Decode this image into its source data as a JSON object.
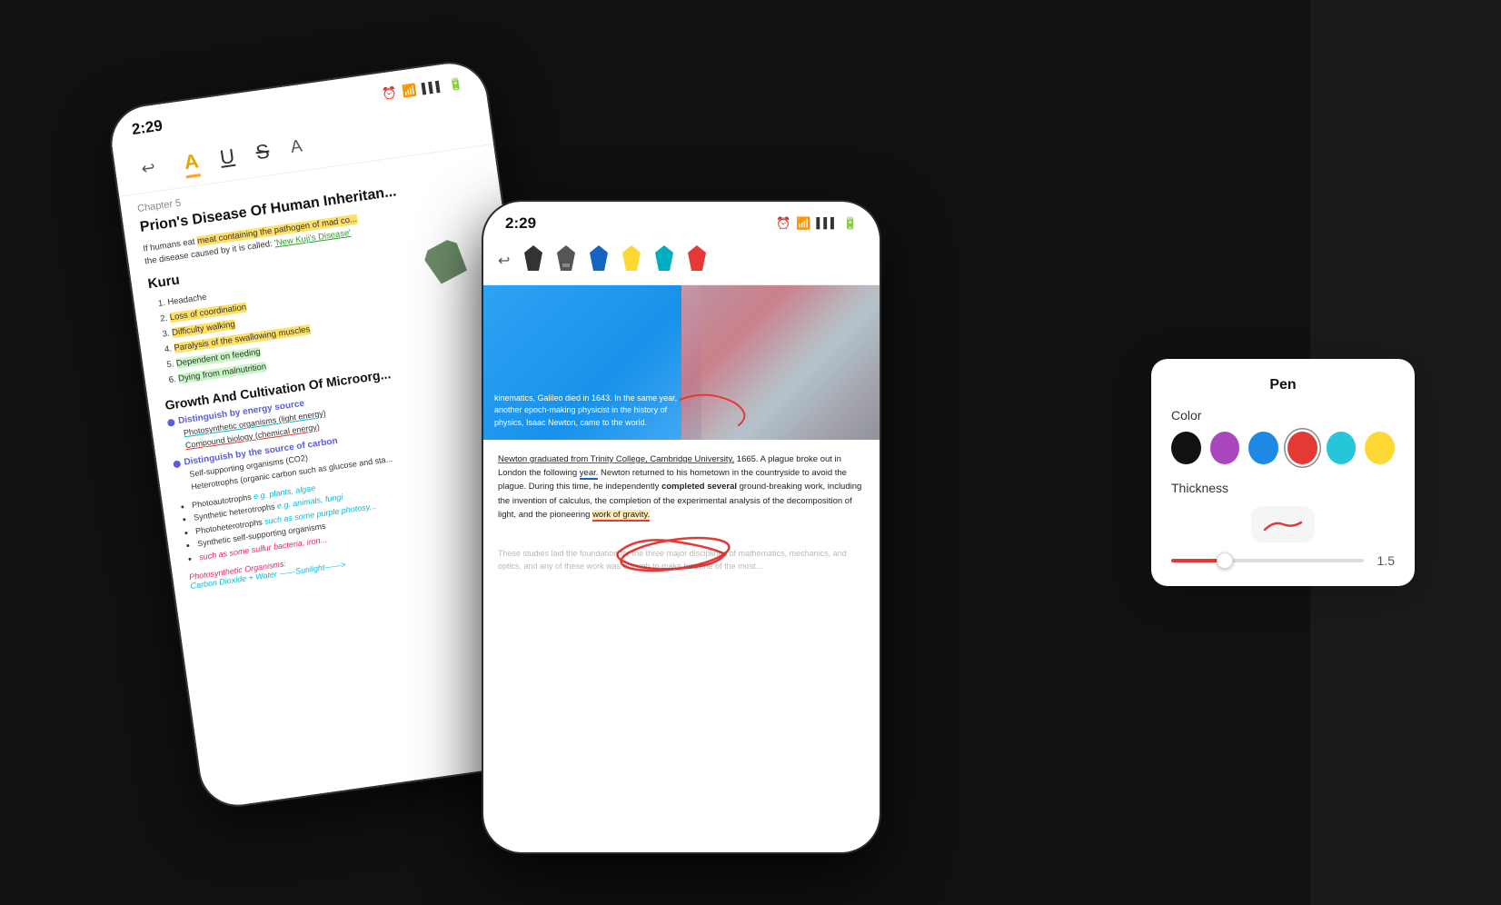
{
  "background": "#111",
  "phones": {
    "back": {
      "time": "2:29",
      "toolbar": {
        "icons": [
          "↩",
          "A",
          "U",
          "S",
          "A"
        ]
      },
      "content": {
        "chapter": "Chapter 5",
        "title": "Prion's Disease Of Human Inheritan...",
        "para1": "If humans eat meat containing the pathogen of mad co...\nthe disease caused by it is called: 'New Kuji's Disease'",
        "kuru_title": "Kuru",
        "kuru_list": [
          "1. Headache",
          "2. Loss of coordination",
          "3. Difficulty walking",
          "4. Paralysis of the swallowing muscles",
          "5. Dependent on feeding",
          "6. Dying from malnutrition"
        ],
        "growth_title": "Growth And Cultivation Of Microorg...",
        "sections": [
          {
            "header": "Distinguish by energy source",
            "items": [
              "Photosynthetic organisms (light energy)",
              "Compound biology (chemical energy)"
            ]
          },
          {
            "header": "Distinguish by the source of carbon",
            "items": [
              "Self-supporting organisms (CO2)",
              "Heterotrophs (organic carbon such as glucose and sta..."
            ]
          }
        ],
        "bullets": [
          "Photoautotrophs e.g. plants, algae",
          "Synthetic heterotrophs e.g. animals, fungi",
          "Photoheterotrophs such as some purple photosy...",
          "Synthetic self-supporting organisms",
          "such as some sulfur bacteria, iron..."
        ],
        "handwritten": "Photosynthetic Organisms:",
        "formula": "Carbon Dioxide + Water ——Sunlight——>"
      }
    },
    "front": {
      "time": "2:29",
      "toolbar_icons": [
        "pen",
        "highlighter-dark",
        "highlighter-blue",
        "highlighter-yellow",
        "highlighter-teal",
        "highlighter-red"
      ],
      "doc_image_text": "kinematics, Galileo died\nin 1643. In the same year,\nanother epoch-making\nphysicist in the history of\nphysics, Isaac Newton,\ncame to the world.",
      "newton_para": "Newton graduated from Trinity College, Cambridge University, 1665. A plague broke out in London the following year. Newton returned to his hometown in the countryside to avoid the plague. During this time, he independently completed several ground-breaking work, including the invention of calculus, the completion of the experimental analysis of the decomposition of light, and the pioneering work of gravity.",
      "completed_several": "completed several",
      "faded_text": "These studies laid the foundation for the three major disciplines of mathematics, mechanics, and optics, and any of these work was enough to make him one of the most..."
    }
  },
  "pen_popup": {
    "title": "Pen",
    "color_label": "Color",
    "colors": [
      "#111111",
      "#ab47bc",
      "#1e88e5",
      "#e53935",
      "#26c6da",
      "#fdd835"
    ],
    "selected_color_index": 3,
    "thickness_label": "Thickness",
    "thickness_value": "1.5"
  },
  "icons": {
    "clock": "🕐",
    "wifi": "WiFi",
    "signal": "▋▋▋",
    "battery": "🔋"
  }
}
